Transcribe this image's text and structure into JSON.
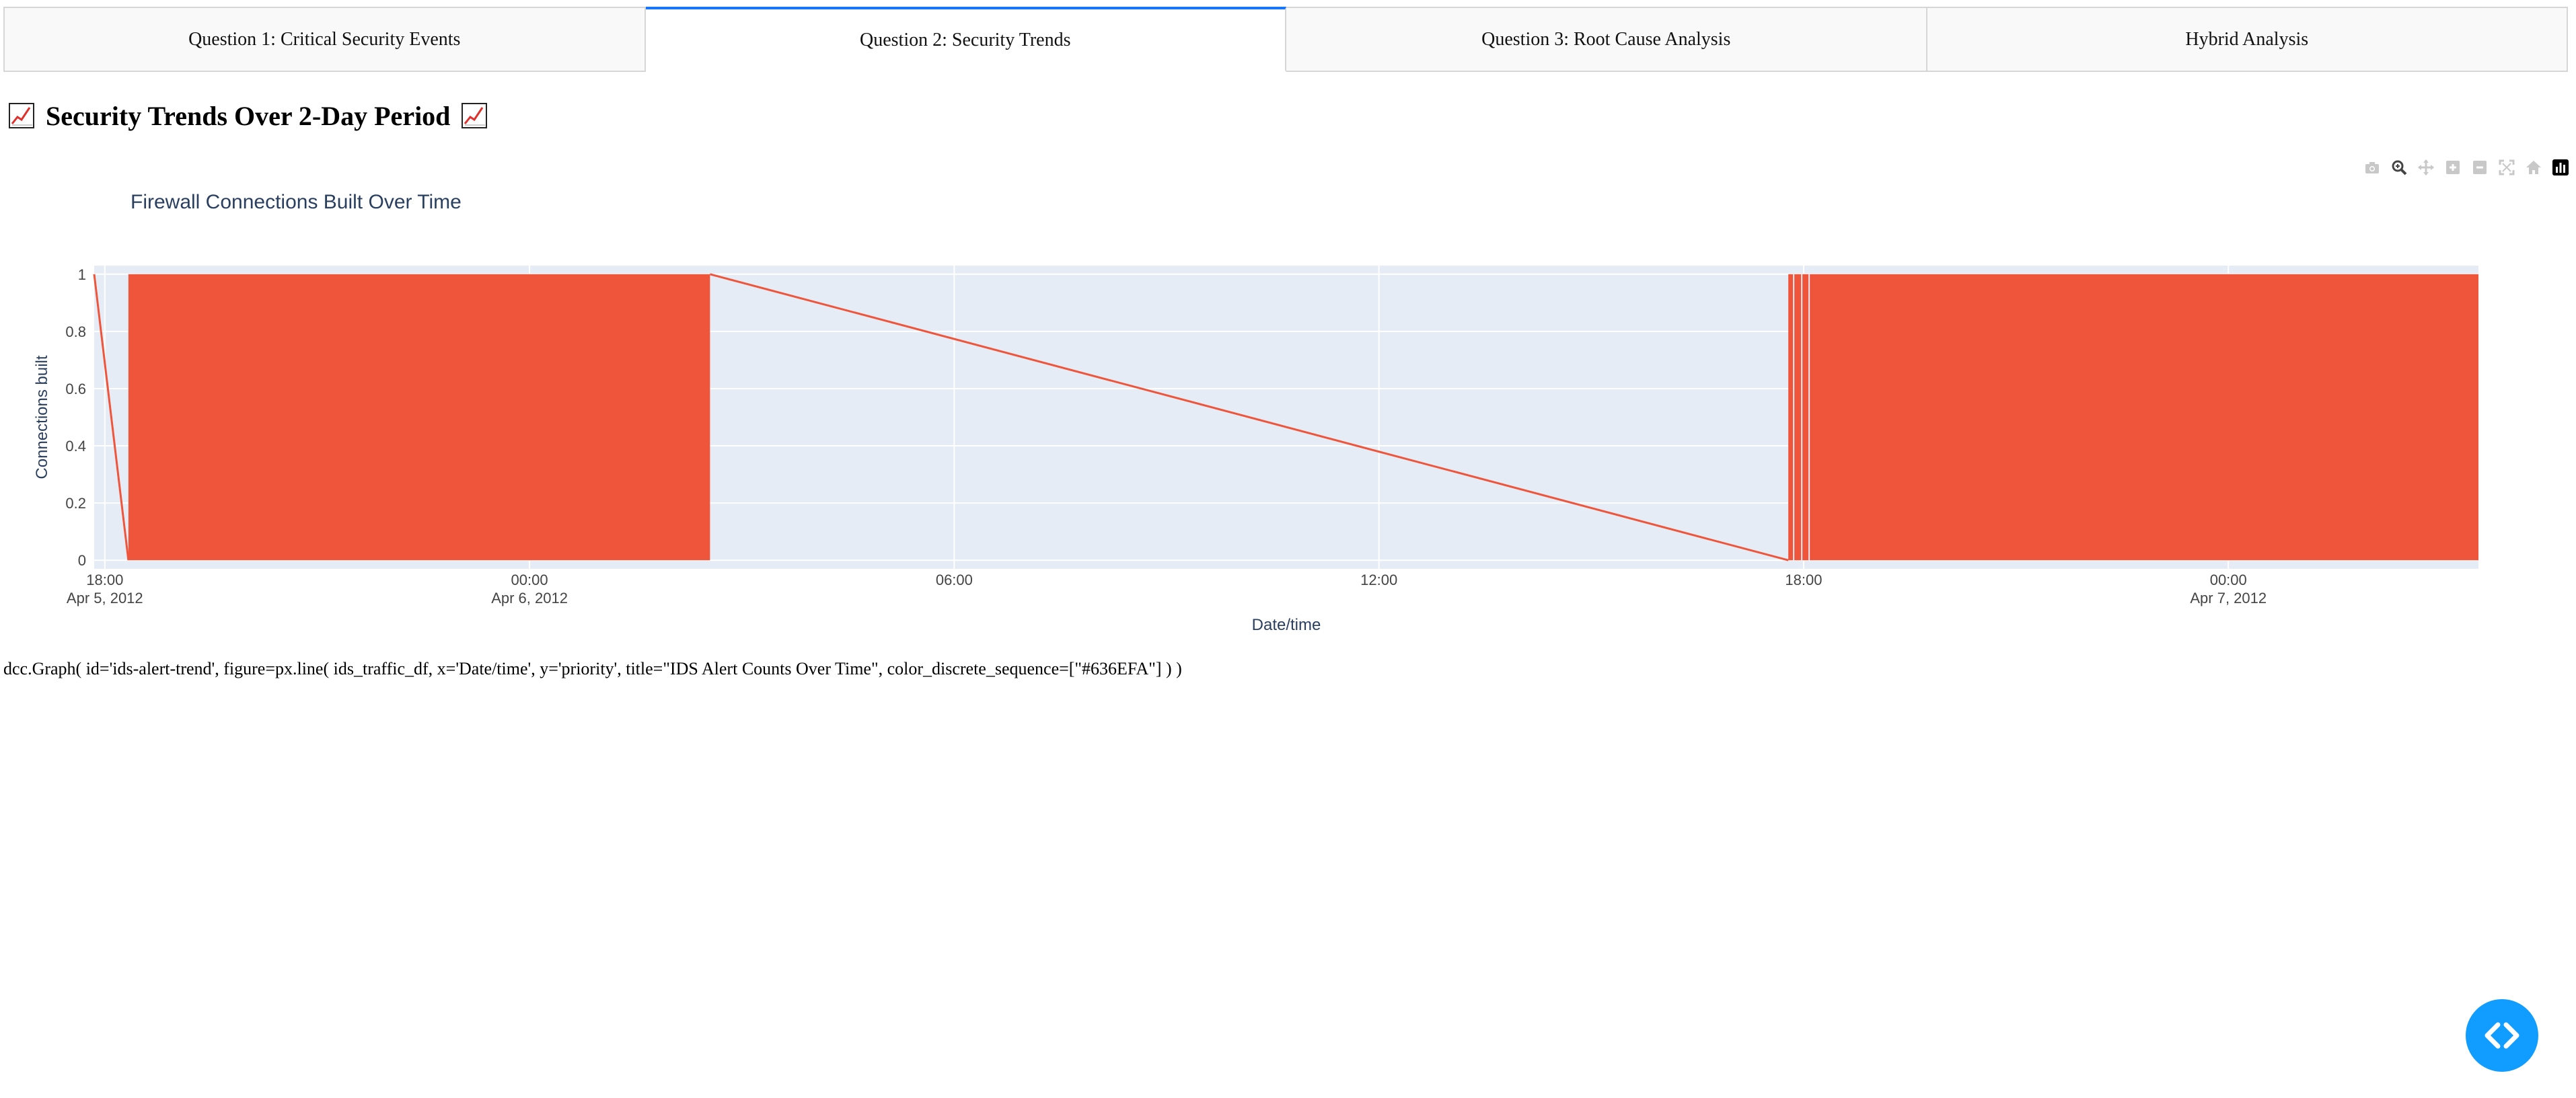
{
  "tabs": [
    {
      "label": "Question 1: Critical Security Events",
      "active": false
    },
    {
      "label": "Question 2: Security Trends",
      "active": true
    },
    {
      "label": "Question 3: Root Cause Analysis",
      "active": false
    },
    {
      "label": "Hybrid Analysis",
      "active": false
    }
  ],
  "heading": {
    "text": "Security Trends Over 2-Day Period",
    "icon": "chart-increasing-icon"
  },
  "code_text": "dcc.Graph( id='ids-alert-trend', figure=px.line( ids_traffic_df, x='Date/time', y='priority', title=\"IDS Alert Counts Over Time\", color_discrete_sequence=[\"#636EFA\"] ) )",
  "modebar": {
    "buttons": [
      "camera-icon",
      "zoom-icon",
      "pan-icon",
      "zoom-in-icon",
      "zoom-out-icon",
      "autoscale-icon",
      "reset-axes-icon",
      "plotly-logo-icon"
    ]
  },
  "colors": {
    "line": "#EF553B",
    "plot_bg": "#E5ECF6",
    "axis_text": "#2a3f5f",
    "tab_accent": "#1975FA",
    "fab": "#119DFF"
  },
  "chart_data": {
    "type": "line",
    "title": "Firewall Connections Built Over Time",
    "xlabel": "Date/time",
    "ylabel": "Connections built",
    "ylim": [
      0,
      1
    ],
    "xlim": [
      "2012-04-05 17:51",
      "2012-04-07 03:32"
    ],
    "y_ticks": [
      "0",
      "0.2",
      "0.4",
      "0.6",
      "0.8",
      "1"
    ],
    "x_ticks": [
      {
        "time": "2012-04-05 18:00",
        "label": "18:00",
        "sublabel": "Apr 5, 2012"
      },
      {
        "time": "2012-04-06 00:00",
        "label": "00:00",
        "sublabel": "Apr 6, 2012"
      },
      {
        "time": "2012-04-06 06:00",
        "label": "06:00",
        "sublabel": ""
      },
      {
        "time": "2012-04-06 12:00",
        "label": "12:00",
        "sublabel": ""
      },
      {
        "time": "2012-04-06 18:00",
        "label": "18:00",
        "sublabel": ""
      },
      {
        "time": "2012-04-07 00:00",
        "label": "00:00",
        "sublabel": "Apr 7, 2012"
      }
    ],
    "grid": true,
    "series": [
      {
        "segments": [
          {
            "kind": "line",
            "points": [
              [
                "2012-04-05 17:51",
                1
              ],
              [
                "2012-04-05 18:20",
                0
              ]
            ]
          },
          {
            "kind": "dense_oscillation",
            "from": "2012-04-05 18:20",
            "to": "2012-04-06 02:33",
            "min": 0,
            "max": 1
          },
          {
            "kind": "line",
            "points": [
              [
                "2012-04-06 02:33",
                1
              ],
              [
                "2012-04-06 17:47",
                0
              ]
            ]
          },
          {
            "kind": "dense_oscillation",
            "from": "2012-04-06 17:47",
            "to": "2012-04-07 03:32",
            "min": 0,
            "max": 1
          }
        ]
      }
    ]
  }
}
